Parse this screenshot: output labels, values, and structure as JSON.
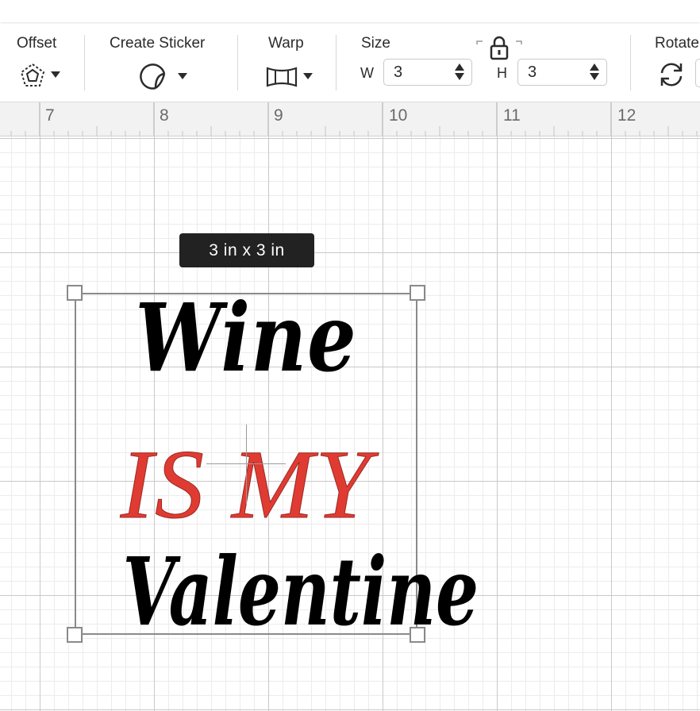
{
  "toolbar": {
    "offset": {
      "label": "Offset",
      "icon": "offset-pentagon-icon"
    },
    "create_sticker": {
      "label": "Create Sticker",
      "icon": "sticker-peel-icon"
    },
    "warp": {
      "label": "Warp",
      "icon": "warp-icon"
    },
    "size": {
      "label": "Size",
      "width_label": "W",
      "width_value": "3",
      "height_label": "H",
      "height_value": "3",
      "lock_icon": "lock-icon"
    },
    "rotate": {
      "label": "Rotate",
      "icon": "rotate-icon"
    }
  },
  "ruler": {
    "numbers": [
      "7",
      "8",
      "9",
      "10",
      "11",
      "12"
    ]
  },
  "canvas": {
    "size_tooltip": "3  in x 3  in",
    "design": {
      "line1": "Wine",
      "line2": "IS MY",
      "line3": "Valentine",
      "accent_color": "#e03b32",
      "text_color": "#000000"
    }
  }
}
